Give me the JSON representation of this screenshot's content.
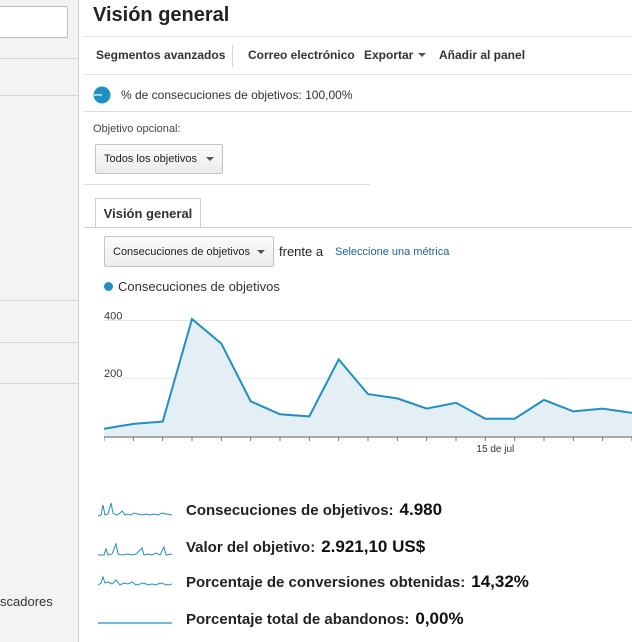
{
  "sidebar": {
    "partial_item_text": "scadores"
  },
  "header": {
    "title": "Visión general"
  },
  "toolbar": {
    "advanced_segments": "Segmentos avanzados",
    "email": "Correo electrónico",
    "export": "Exportar",
    "add_to_dashboard": "Añadir al panel"
  },
  "goal_completion": {
    "label": "% de consecuciones de objetivos: 100,00%"
  },
  "optional_goal": {
    "label": "Objetivo opcional:",
    "selected": "Todos los objetivos"
  },
  "tabs": [
    {
      "label": "Visión general"
    }
  ],
  "metric_selector": {
    "selected": "Consecuciones de objetivos",
    "versus_text": "frente a",
    "select_metric_link": "Seleccione una métrica"
  },
  "colors": {
    "accent": "#1f8fc4",
    "area_fill": "#e3eef5",
    "link": "#1e5fa8"
  },
  "chart_data": {
    "type": "area",
    "series": [
      {
        "name": "Consecuciones de objetivos",
        "values": [
          25,
          42,
          50,
          405,
          320,
          120,
          75,
          68,
          265,
          145,
          130,
          95,
          115,
          60,
          60,
          125,
          85,
          95,
          80
        ]
      }
    ],
    "y_ticks": [
      "400",
      "200"
    ],
    "x_tick_label": "15 de jul",
    "x_tick_index": 13,
    "ylim": [
      0,
      450
    ],
    "grid": true
  },
  "summary": [
    {
      "label": "Consecuciones de objetivos:",
      "value": "4.980"
    },
    {
      "label": "Valor del objetivo:",
      "value": "2.921,10 US$"
    },
    {
      "label": "Porcentaje de conversiones obtenidas:",
      "value": "14,32%"
    },
    {
      "label": "Porcentaje total de abandonos:",
      "value": "0,00%"
    }
  ]
}
